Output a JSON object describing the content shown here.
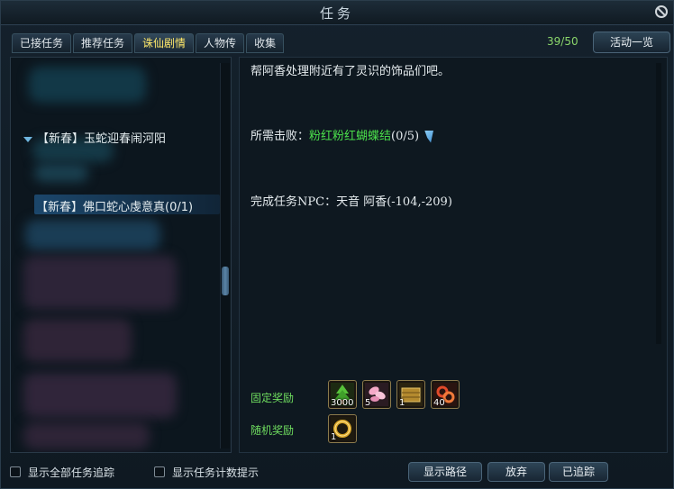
{
  "window": {
    "title": "任务"
  },
  "tabs": [
    {
      "label": "已接任务",
      "active": false
    },
    {
      "label": "推荐任务",
      "active": false
    },
    {
      "label": "诛仙剧情",
      "active": true
    },
    {
      "label": "人物传",
      "active": false
    },
    {
      "label": "收集",
      "active": false
    }
  ],
  "quest_count": "39/50",
  "activity_button": "活动一览",
  "quest_tree": {
    "group_label": "【新春】玉蛇迎春闹河阳",
    "selected_quest": "【新春】佛口蛇心虔意真(0/1)"
  },
  "detail": {
    "description": "帮阿香处理附近有了灵识的饰品们吧。",
    "requirement_label": "所需击败：",
    "requirement_target": "粉红粉红蝴蝶结",
    "requirement_progress": "(0/5)",
    "npc_line": "完成任务NPC：天音 阿香(-104,-209)"
  },
  "rewards": {
    "fixed_label": "固定奖励",
    "random_label": "随机奖励",
    "fixed_items": [
      {
        "icon": "green-tree-icon",
        "qty": "3000"
      },
      {
        "icon": "pink-petals-icon",
        "qty": "5"
      },
      {
        "icon": "gold-chest-icon",
        "qty": "1"
      },
      {
        "icon": "red-ring-icon",
        "qty": "40"
      }
    ],
    "random_items": [
      {
        "icon": "gold-ring-icon",
        "qty": "1"
      }
    ]
  },
  "footer": {
    "show_all_tracking": "显示全部任务追踪",
    "show_count_hint": "显示任务计数提示",
    "show_path_button": "显示路径",
    "abandon_button": "放弃",
    "tracked_button": "已追踪"
  },
  "colors": {
    "active_tab": "#ffe86a",
    "count": "#8bd66b",
    "target_green": "#4be04b",
    "reward_label": "#6fdd5f"
  }
}
